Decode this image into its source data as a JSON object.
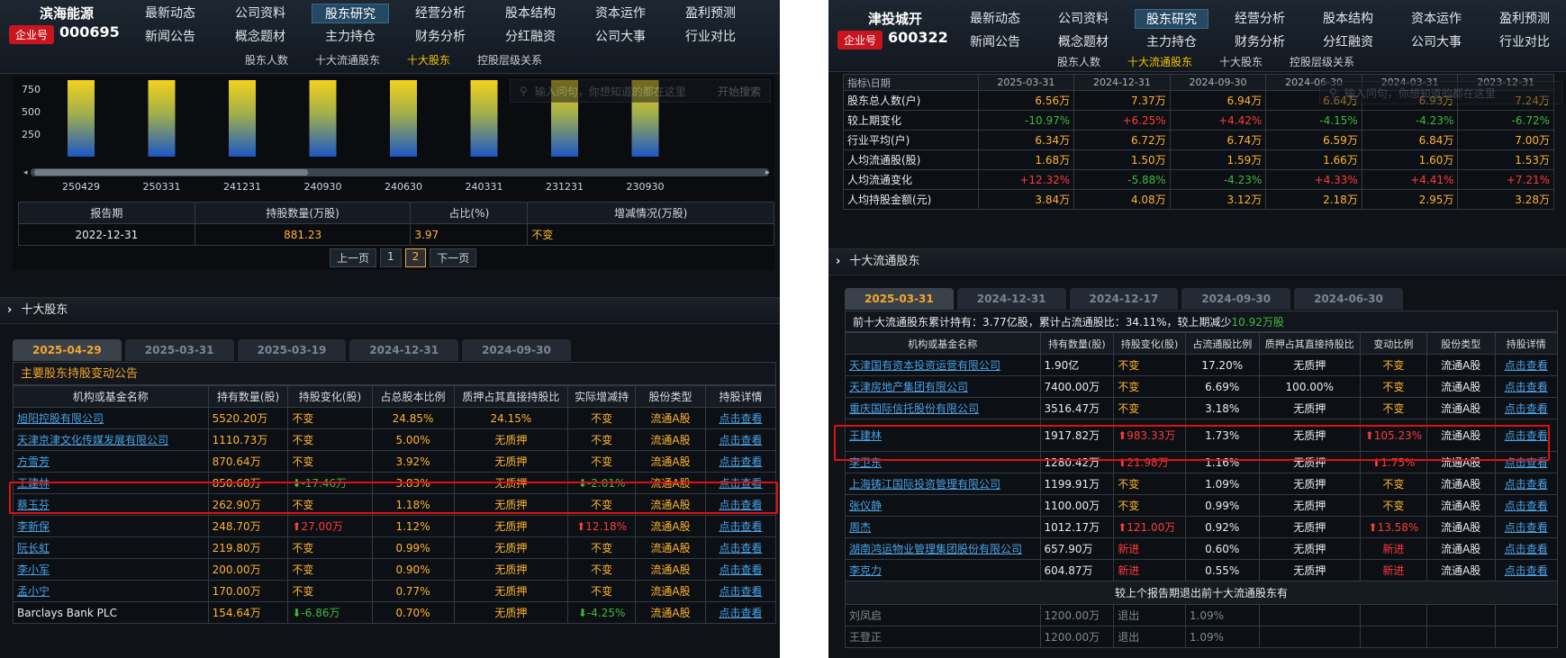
{
  "left": {
    "company": {
      "name": "滨海能源",
      "tag": "企业号",
      "code": "000695"
    },
    "nav_row1": [
      "最新动态",
      "公司资料",
      "股东研究",
      "经营分析",
      "股本结构",
      "资本运作",
      "盈利预测"
    ],
    "nav_row2": [
      "新闻公告",
      "概念题材",
      "主力持仓",
      "财务分析",
      "分红融资",
      "公司大事",
      "行业对比"
    ],
    "nav_selected": "股东研究",
    "subnav": [
      "股东人数",
      "十大流通股东",
      "十大股东",
      "控股层级关系"
    ],
    "subnav_selected": "十大股东",
    "search_placeholder": "输入问句，你想知道的都在这里",
    "search_button": "开始搜索",
    "chart": {
      "y_ticks": [
        "750",
        "500",
        "250"
      ],
      "x_labels": [
        "250429",
        "250331",
        "241231",
        "240930",
        "240630",
        "240331",
        "231231",
        "230930"
      ]
    },
    "chart_data": {
      "type": "bar",
      "categories": [
        "250429",
        "250331",
        "241231",
        "240930",
        "240630",
        "240331",
        "231231",
        "230930"
      ],
      "values": [
        850,
        850,
        850,
        850,
        850,
        850,
        850,
        850
      ],
      "ylim": [
        0,
        900
      ]
    },
    "hist_table": {
      "headers": [
        "报告期",
        "持股数量(万股)",
        "占比(%)",
        "增减情况(万股)"
      ],
      "row": [
        "2022-12-31",
        "881.23",
        "3.97",
        "不变"
      ]
    },
    "pager": {
      "prev": "上一页",
      "pages": [
        "1",
        "2"
      ],
      "current": "2",
      "next": "下一页"
    },
    "section_title": "十大股东",
    "tabs": [
      "2025-04-29",
      "2025-03-31",
      "2025-03-19",
      "2024-12-31",
      "2024-09-30"
    ],
    "tab_selected": "2025-04-29",
    "caption": "主要股东持股变动公告",
    "headers": [
      "机构或基金名称",
      "持有数量(股)",
      "持股变化(股)",
      "占总股本比例",
      "质押占其直接持股比",
      "实际增减持",
      "股份类型",
      "持股详情"
    ],
    "rows": [
      {
        "name": "旭阳控股有限公司",
        "link": true,
        "qty": "5520.20万",
        "chg": "不变",
        "chg_dir": "",
        "pct": "24.85%",
        "pledge": "24.15%",
        "act": "不变",
        "act_dir": "",
        "type": "流通A股",
        "detail": "点击查看"
      },
      {
        "name": "天津京津文化传媒发展有限公司",
        "link": true,
        "qty": "1110.73万",
        "chg": "不变",
        "chg_dir": "",
        "pct": "5.00%",
        "pledge": "无质押",
        "act": "不变",
        "act_dir": "",
        "type": "流通A股",
        "detail": "点击查看"
      },
      {
        "name": "方雪芳",
        "link": true,
        "qty": "870.64万",
        "chg": "不变",
        "chg_dir": "",
        "pct": "3.92%",
        "pledge": "无质押",
        "act": "不变",
        "act_dir": "",
        "type": "流通A股",
        "detail": "点击查看"
      },
      {
        "name": "王建林",
        "link": true,
        "qty": "850.68万",
        "chg": "-17.46万",
        "chg_dir": "down",
        "pct": "3.83%",
        "pledge": "无质押",
        "act": "-2.01%",
        "act_dir": "down",
        "type": "流通A股",
        "detail": "点击查看"
      },
      {
        "name": "蔡玉芬",
        "link": true,
        "qty": "262.90万",
        "chg": "不变",
        "chg_dir": "",
        "pct": "1.18%",
        "pledge": "无质押",
        "act": "不变",
        "act_dir": "",
        "type": "流通A股",
        "detail": "点击查看"
      },
      {
        "name": "李新保",
        "link": true,
        "qty": "248.70万",
        "chg": "27.00万",
        "chg_dir": "up",
        "pct": "1.12%",
        "pledge": "无质押",
        "act": "12.18%",
        "act_dir": "up",
        "type": "流通A股",
        "detail": "点击查看"
      },
      {
        "name": "阮长虹",
        "link": true,
        "qty": "219.80万",
        "chg": "不变",
        "chg_dir": "",
        "pct": "0.99%",
        "pledge": "无质押",
        "act": "不变",
        "act_dir": "",
        "type": "流通A股",
        "detail": "点击查看"
      },
      {
        "name": "李小军",
        "link": true,
        "qty": "200.00万",
        "chg": "不变",
        "chg_dir": "",
        "pct": "0.90%",
        "pledge": "无质押",
        "act": "不变",
        "act_dir": "",
        "type": "流通A股",
        "detail": "点击查看"
      },
      {
        "name": "孟小宁",
        "link": true,
        "qty": "170.00万",
        "chg": "不变",
        "chg_dir": "",
        "pct": "0.77%",
        "pledge": "无质押",
        "act": "不变",
        "act_dir": "",
        "type": "流通A股",
        "detail": "点击查看"
      },
      {
        "name": "Barclays Bank PLC",
        "link": false,
        "qty": "154.64万",
        "chg": "-6.86万",
        "chg_dir": "down",
        "pct": "0.70%",
        "pledge": "无质押",
        "act": "-4.25%",
        "act_dir": "down",
        "type": "流通A股",
        "detail": "点击查看"
      }
    ]
  },
  "right": {
    "company": {
      "name": "津投城开",
      "tag": "企业号",
      "code": "600322"
    },
    "nav_row1": [
      "最新动态",
      "公司资料",
      "股东研究",
      "经营分析",
      "股本结构",
      "资本运作",
      "盈利预测"
    ],
    "nav_row2": [
      "新闻公告",
      "概念题材",
      "主力持仓",
      "财务分析",
      "分红融资",
      "公司大事",
      "行业对比"
    ],
    "nav_selected": "股东研究",
    "subnav": [
      "股东人数",
      "十大流通股东",
      "十大股东",
      "控股层级关系"
    ],
    "subnav_selected": "十大流通股东",
    "search_placeholder": "输入问句，你想知道的都在这里",
    "stats_headers": [
      "指标\\日期",
      "2025-03-31",
      "2024-12-31",
      "2024-09-30",
      "2024-06-30",
      "2024-03-31",
      "2023-12-31"
    ],
    "stats_rows": [
      {
        "label": "股东总人数(户)",
        "vals": [
          "6.56万",
          "7.37万",
          "6.94万",
          "6.64万",
          "6.93万",
          "7.24万"
        ],
        "cls": [
          "org",
          "org",
          "org",
          "org",
          "org",
          "org"
        ]
      },
      {
        "label": "较上期变化",
        "vals": [
          "-10.97%",
          "+6.25%",
          "+4.42%",
          "-4.15%",
          "-4.23%",
          "-6.72%"
        ],
        "cls": [
          "grn",
          "red",
          "red",
          "grn",
          "grn",
          "grn"
        ]
      },
      {
        "label": "行业平均(户)",
        "vals": [
          "6.34万",
          "6.72万",
          "6.74万",
          "6.59万",
          "6.84万",
          "7.00万"
        ],
        "cls": [
          "org",
          "org",
          "org",
          "org",
          "org",
          "org"
        ]
      },
      {
        "label": "人均流通股(股)",
        "vals": [
          "1.68万",
          "1.50万",
          "1.59万",
          "1.66万",
          "1.60万",
          "1.53万"
        ],
        "cls": [
          "org",
          "org",
          "org",
          "org",
          "org",
          "org"
        ]
      },
      {
        "label": "人均流通变化",
        "vals": [
          "+12.32%",
          "-5.88%",
          "-4.23%",
          "+4.33%",
          "+4.41%",
          "+7.21%"
        ],
        "cls": [
          "red",
          "grn",
          "grn",
          "red",
          "red",
          "red"
        ]
      },
      {
        "label": "人均持股金额(元)",
        "vals": [
          "3.84万",
          "4.08万",
          "3.12万",
          "2.18万",
          "2.95万",
          "3.28万"
        ],
        "cls": [
          "org",
          "org",
          "org",
          "org",
          "org",
          "org"
        ]
      }
    ],
    "section_title": "十大流通股东",
    "tabs": [
      "2025-03-31",
      "2024-12-31",
      "2024-12-17",
      "2024-09-30",
      "2024-06-30"
    ],
    "tab_selected": "2025-03-31",
    "summary": {
      "prefix": "前十大流通股东累计持有：",
      "total": "3.77亿股",
      "mid": "，累计占流通股比：",
      "ratio": "34.11%",
      "mid2": "，较上期减少",
      "change": "10.92万股"
    },
    "headers": [
      "机构或基金名称",
      "持有数量(股)",
      "持股变化(股)",
      "占流通股比例",
      "质押占其直接持股比",
      "变动比例",
      "股份类型",
      "持股详情"
    ],
    "rows": [
      {
        "name": "天津国有资本投资运营有限公司",
        "qty": "1.90亿",
        "chg": "不变",
        "chg_dir": "",
        "pct": "17.20%",
        "pledge": "无质押",
        "ratio": "不变",
        "ratio_dir": "",
        "type": "流通A股",
        "detail": "点击查看"
      },
      {
        "name": "天津房地产集团有限公司",
        "qty": "7400.00万",
        "chg": "不变",
        "chg_dir": "",
        "pct": "6.69%",
        "pledge": "100.00%",
        "ratio": "不变",
        "ratio_dir": "",
        "type": "流通A股",
        "detail": "点击查看"
      },
      {
        "name": "重庆国际信托股份有限公司",
        "qty": "3516.47万",
        "chg": "不变",
        "chg_dir": "",
        "pct": "3.18%",
        "pledge": "无质押",
        "ratio": "不变",
        "ratio_dir": "",
        "type": "流通A股",
        "detail": "点击查看"
      },
      {
        "name": "王建林",
        "qty": "1917.82万",
        "chg": "983.33万",
        "chg_dir": "up",
        "pct": "1.73%",
        "pledge": "无质押",
        "ratio": "105.23%",
        "ratio_dir": "up",
        "type": "流通A股",
        "detail": "点击查看"
      },
      {
        "name": "李卫东",
        "qty": "1280.42万",
        "chg": "21.98万",
        "chg_dir": "up",
        "pct": "1.16%",
        "pledge": "无质押",
        "ratio": "1.75%",
        "ratio_dir": "up",
        "type": "流通A股",
        "detail": "点击查看"
      },
      {
        "name": "上海铸江国际投资管理有限公司",
        "qty": "1199.91万",
        "chg": "不变",
        "chg_dir": "",
        "pct": "1.09%",
        "pledge": "无质押",
        "ratio": "不变",
        "ratio_dir": "",
        "type": "流通A股",
        "detail": "点击查看"
      },
      {
        "name": "张仪静",
        "qty": "1100.00万",
        "chg": "不变",
        "chg_dir": "",
        "pct": "0.99%",
        "pledge": "无质押",
        "ratio": "不变",
        "ratio_dir": "",
        "type": "流通A股",
        "detail": "点击查看"
      },
      {
        "name": "周杰",
        "qty": "1012.17万",
        "chg": "121.00万",
        "chg_dir": "up",
        "pct": "0.92%",
        "pledge": "无质押",
        "ratio": "13.58%",
        "ratio_dir": "up",
        "type": "流通A股",
        "detail": "点击查看"
      },
      {
        "name": "湖南鸿运物业管理集团股份有限公司",
        "qty": "657.90万",
        "chg": "新进",
        "chg_dir": "new",
        "pct": "0.60%",
        "pledge": "无质押",
        "ratio": "新进",
        "ratio_dir": "new",
        "type": "流通A股",
        "detail": "点击查看"
      },
      {
        "name": "李克力",
        "qty": "604.87万",
        "chg": "新进",
        "chg_dir": "new",
        "pct": "0.55%",
        "pledge": "无质押",
        "ratio": "新进",
        "ratio_dir": "new",
        "type": "流通A股",
        "detail": "点击查看"
      }
    ],
    "exit_caption": "较上个报告期退出前十大流通股东有",
    "exit_rows": [
      {
        "name": "刘凤启",
        "qty": "1200.00万",
        "chg": "退出",
        "pct": "1.09%"
      },
      {
        "name": "王登正",
        "qty": "1200.00万",
        "chg": "退出",
        "pct": "1.09%"
      }
    ]
  }
}
